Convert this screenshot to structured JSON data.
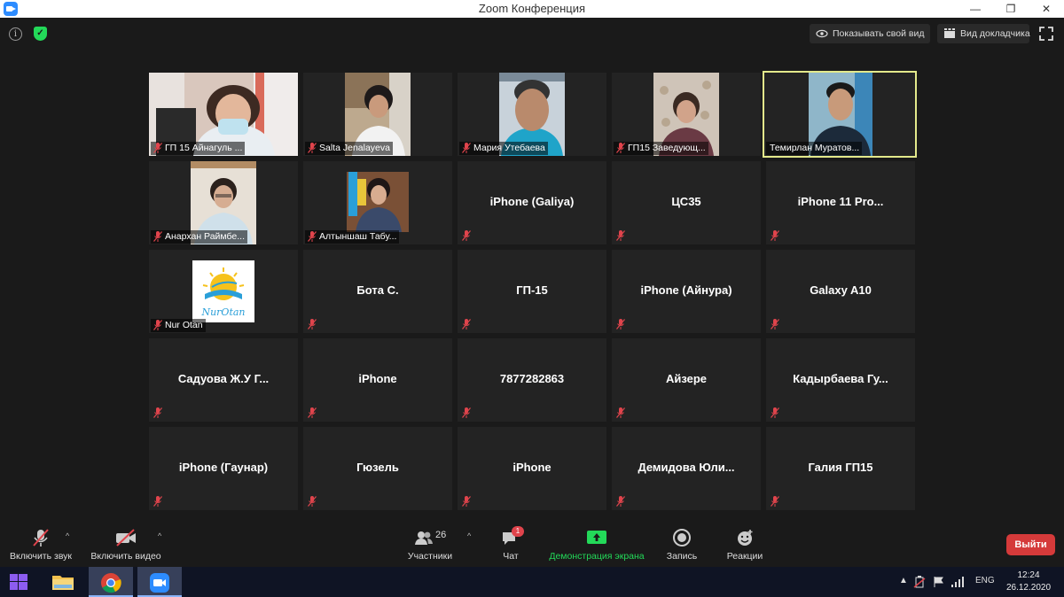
{
  "window": {
    "title": "Zoom Конференция",
    "minimize": "—",
    "restore": "❐",
    "close": "✕"
  },
  "topbar": {
    "info": "i",
    "security": "✓",
    "show_view": "Показывать свой вид",
    "speaker_view": "Вид докладчика"
  },
  "tiles": [
    {
      "name": "ГП 15 Айнагуль ...",
      "type": "video",
      "muted": true
    },
    {
      "name": "Salta Jenalayeva",
      "type": "video",
      "muted": true
    },
    {
      "name": "Мария Утебаева",
      "type": "video",
      "muted": true
    },
    {
      "name": "ГП15 Заведующ...",
      "type": "video",
      "muted": true
    },
    {
      "name": "Темирлан Муратов...",
      "type": "video",
      "muted": false,
      "active": true
    },
    {
      "name": "Анархан Раймбе...",
      "type": "video",
      "muted": true
    },
    {
      "name": "Алтыншаш Табу...",
      "type": "video",
      "muted": true
    },
    {
      "name": "iPhone (Galiya)",
      "type": "name",
      "muted": true
    },
    {
      "name": "ЦС35",
      "type": "name",
      "muted": true
    },
    {
      "name": "iPhone 11 Pro...",
      "type": "name",
      "muted": true
    },
    {
      "name": "Nur Otan",
      "type": "logo",
      "muted": true,
      "logo_text": "NurOtan"
    },
    {
      "name": "Бота С.",
      "type": "name",
      "muted": true
    },
    {
      "name": "ГП-15",
      "type": "name",
      "muted": true
    },
    {
      "name": "iPhone (Айнура)",
      "type": "name",
      "muted": true
    },
    {
      "name": "Galaxy A10",
      "type": "name",
      "muted": true
    },
    {
      "name": "Садуова Ж.У Г...",
      "type": "name",
      "muted": true
    },
    {
      "name": "iPhone",
      "type": "name",
      "muted": true
    },
    {
      "name": "7877282863",
      "type": "name",
      "muted": true
    },
    {
      "name": "Айзере",
      "type": "name",
      "muted": true
    },
    {
      "name": "Кадырбаева Гу...",
      "type": "name",
      "muted": true
    },
    {
      "name": "iPhone (Гаунар)",
      "type": "name",
      "muted": true
    },
    {
      "name": "Гюзель",
      "type": "name",
      "muted": true
    },
    {
      "name": "iPhone",
      "type": "name",
      "muted": true
    },
    {
      "name": "Демидова Юли...",
      "type": "name",
      "muted": true
    },
    {
      "name": "Галия ГП15",
      "type": "name",
      "muted": true
    }
  ],
  "toolbar": {
    "audio": "Включить звук",
    "video": "Включить видео",
    "participants_count": "26",
    "participants": "Участники",
    "chat_badge": "1",
    "chat": "Чат",
    "share": "Демонстрация экрана",
    "record": "Запись",
    "reactions": "Реакции",
    "leave": "Выйти",
    "caret": "^"
  },
  "taskbar": {
    "language": "ENG",
    "time": "12:24",
    "date": "26.12.2020",
    "tray_arrow": "▲"
  },
  "colors": {
    "active_speaker": "#e3e98b",
    "share_green": "#23d959",
    "leave_red": "#d53a3a",
    "muted_red": "#e0444c"
  }
}
